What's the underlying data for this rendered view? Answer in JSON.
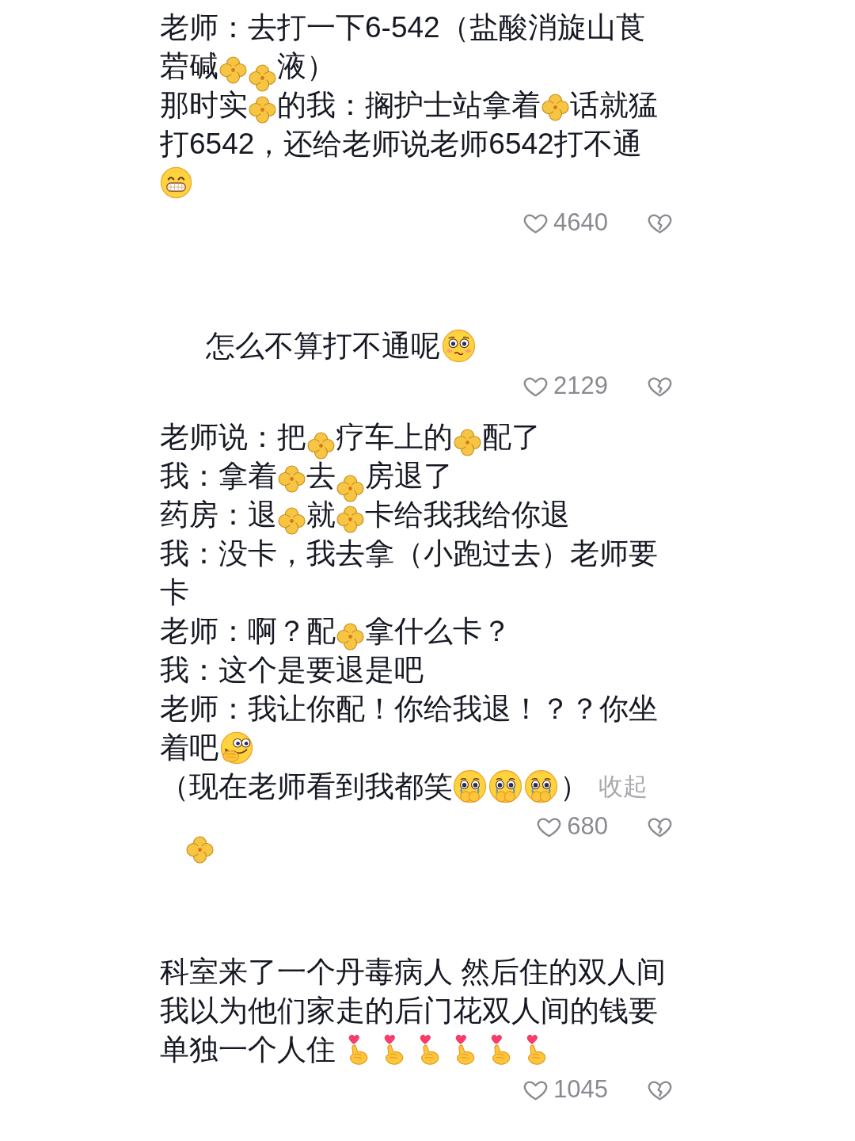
{
  "comments": [
    {
      "lines": [
        [
          {
            "kind": "text",
            "text": "老师：去打一下6-542（盐酸消旋山莨"
          }
        ],
        [
          {
            "kind": "text",
            "text": "菪碱"
          },
          {
            "kind": "sticker"
          },
          {
            "kind": "sticker"
          },
          {
            "kind": "text",
            "text": "液）"
          }
        ],
        [
          {
            "kind": "text",
            "text": "那时实"
          },
          {
            "kind": "sticker"
          },
          {
            "kind": "text",
            "text": "的我：搁护士站拿着"
          },
          {
            "kind": "sticker"
          },
          {
            "kind": "text",
            "text": "话就猛"
          }
        ],
        [
          {
            "kind": "text",
            "text": "打6542，还给老师说老师6542打不通"
          }
        ],
        [
          {
            "kind": "grin"
          }
        ]
      ],
      "likes": "4640",
      "replies": [
        {
          "lines": [
            [
              {
                "kind": "text",
                "text": "怎么不算打不通呢"
              },
              {
                "kind": "worried"
              }
            ]
          ],
          "likes": "2129"
        }
      ]
    },
    {
      "lines": [
        [
          {
            "kind": "text",
            "text": "老师说：把"
          },
          {
            "kind": "sticker"
          },
          {
            "kind": "text",
            "text": "疗车上的"
          },
          {
            "kind": "sticker"
          },
          {
            "kind": "text",
            "text": "配了"
          }
        ],
        [
          {
            "kind": "text",
            "text": "我：拿着"
          },
          {
            "kind": "sticker"
          },
          {
            "kind": "text",
            "text": "去"
          },
          {
            "kind": "sticker"
          },
          {
            "kind": "text",
            "text": "房退了"
          }
        ],
        [
          {
            "kind": "text",
            "text": "药房：退"
          },
          {
            "kind": "sticker"
          },
          {
            "kind": "text",
            "text": "就"
          },
          {
            "kind": "sticker"
          },
          {
            "kind": "text",
            "text": "卡给我我给你退"
          }
        ],
        [
          {
            "kind": "text",
            "text": "我：没卡，我去拿（小跑过去）老师要"
          }
        ],
        [
          {
            "kind": "text",
            "text": "卡"
          }
        ],
        [
          {
            "kind": "text",
            "text": "老师：啊？配"
          },
          {
            "kind": "sticker"
          },
          {
            "kind": "text",
            "text": "拿什么卡？"
          }
        ],
        [
          {
            "kind": "text",
            "text": "我：这个是要退是吧"
          }
        ],
        [
          {
            "kind": "text",
            "text": "老师：我让你配！你给我退！？？你坐"
          }
        ],
        [
          {
            "kind": "text",
            "text": "着吧"
          },
          {
            "kind": "shy"
          }
        ],
        [
          {
            "kind": "text",
            "text": "（现在老师看到我都笑"
          },
          {
            "kind": "crying"
          },
          {
            "kind": "crying"
          },
          {
            "kind": "crying"
          },
          {
            "kind": "text",
            "text": "）"
          },
          {
            "kind": "link",
            "text": "收起"
          }
        ]
      ],
      "likes": "680",
      "sticker_below": true
    },
    {
      "lines": [
        [
          {
            "kind": "text",
            "text": "科室来了一个丹毒病人 然后住的双人间"
          }
        ],
        [
          {
            "kind": "text",
            "text": "我以为他们家走的后门花双人间的钱要"
          }
        ],
        [
          {
            "kind": "text",
            "text": "单独一个人住"
          },
          {
            "kind": "fingerheart"
          },
          {
            "kind": "fingerheart"
          },
          {
            "kind": "fingerheart"
          },
          {
            "kind": "fingerheart"
          },
          {
            "kind": "fingerheart"
          },
          {
            "kind": "fingerheart"
          }
        ]
      ],
      "likes": "1045"
    }
  ]
}
